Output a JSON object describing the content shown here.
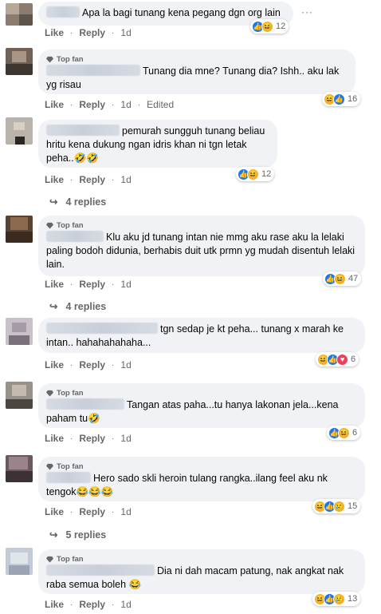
{
  "labels": {
    "top_fan": "Top fan",
    "like": "Like",
    "reply": "Reply",
    "dot": "·",
    "edited": "Edited",
    "more": "···"
  },
  "comments": [
    {
      "text": "Apa la bagi tunang kena pegang dgn org lain",
      "time": "1d",
      "reactions": "12",
      "top_fan": false
    },
    {
      "text": "Tunang dia mne? Tunang dia? Ishh.. aku lak yg risau",
      "time": "1d",
      "edited": true,
      "reactions": "16",
      "top_fan": true
    },
    {
      "text": "pemurah sungguh tunang beliau hritu kena dukung ngan idris khan ni tgn letak peha..🤣🤣",
      "time": "1d",
      "reactions": "12",
      "replies": "4 replies",
      "top_fan": false
    },
    {
      "text": "Klu aku jd tunang intan nie mmg aku rase aku la lelaki paling bodoh didunia, berhabis duit utk prmn yg mudah disentuh lelaki lain.",
      "time": "1d",
      "reactions": "47",
      "replies": "4 replies",
      "top_fan": true
    },
    {
      "text": "tgn sedap je kt peha... tunang x marah ke intan.. hahahahahaha...",
      "time": "1d",
      "reactions": "6",
      "top_fan": false
    },
    {
      "text": "Tangan atas paha...tu hanya lakonan jela...kena paham tu🤣",
      "time": "1d",
      "reactions": "6",
      "top_fan": true
    },
    {
      "text": "Hero sado skli heroin tulang rangka..ilang feel aku nk tengok😂😂😂",
      "time": "1d",
      "reactions": "15",
      "replies": "5 replies",
      "top_fan": true
    },
    {
      "text": "Dia ni dah macam patung, nak angkat nak raba semua boleh 😂",
      "time": "1d",
      "reactions": "13",
      "top_fan": true
    }
  ],
  "colors": {
    "bubble": "#f0f2f5",
    "meta": "#65676b",
    "like": "#1877f2",
    "haha": "#f7b125",
    "love": "#f33e58"
  }
}
